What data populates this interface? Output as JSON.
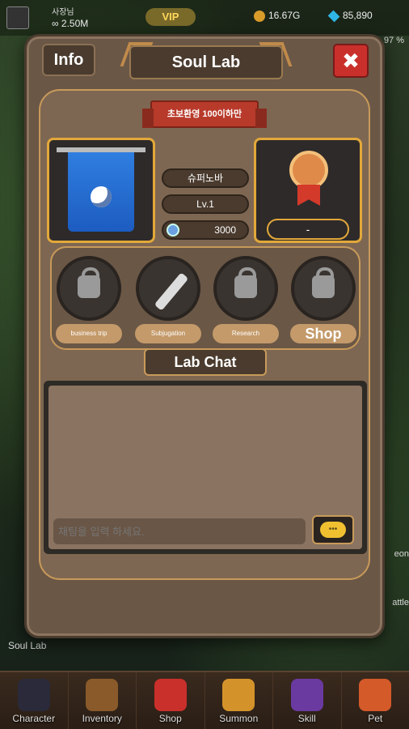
{
  "topbar": {
    "player_name": "사장님",
    "power": "2.50M",
    "vip_label": "VIP",
    "gold": "16.67G",
    "gems": "85,890",
    "progress_text": "97 %"
  },
  "side": {
    "soul_lab_label": "Soul Lab",
    "right_label_1": "eon",
    "right_label_2": "attle"
  },
  "modal": {
    "info_label": "Info",
    "title": "Soul Lab",
    "close_label": "✖",
    "ribbon_text": "초보환영 100이하만",
    "lab_name": "슈퍼노바",
    "lab_level": "Lv.1",
    "lab_points": "3000",
    "rank": "-",
    "menu": [
      {
        "label": "business trip"
      },
      {
        "label": "Subjugation"
      },
      {
        "label": "Research"
      },
      {
        "label": "Shop"
      }
    ],
    "chat_title": "Lab Chat",
    "chat_placeholder": "채팅을 입력 하세요."
  },
  "bottom_nav": [
    {
      "label": "Character",
      "color": "#2a2a3a"
    },
    {
      "label": "Inventory",
      "color": "#8a5a2a"
    },
    {
      "label": "Shop",
      "color": "#c9302c"
    },
    {
      "label": "Summon",
      "color": "#d4932a"
    },
    {
      "label": "Skill",
      "color": "#6a3aa0"
    },
    {
      "label": "Pet",
      "color": "#d45a2a"
    }
  ]
}
